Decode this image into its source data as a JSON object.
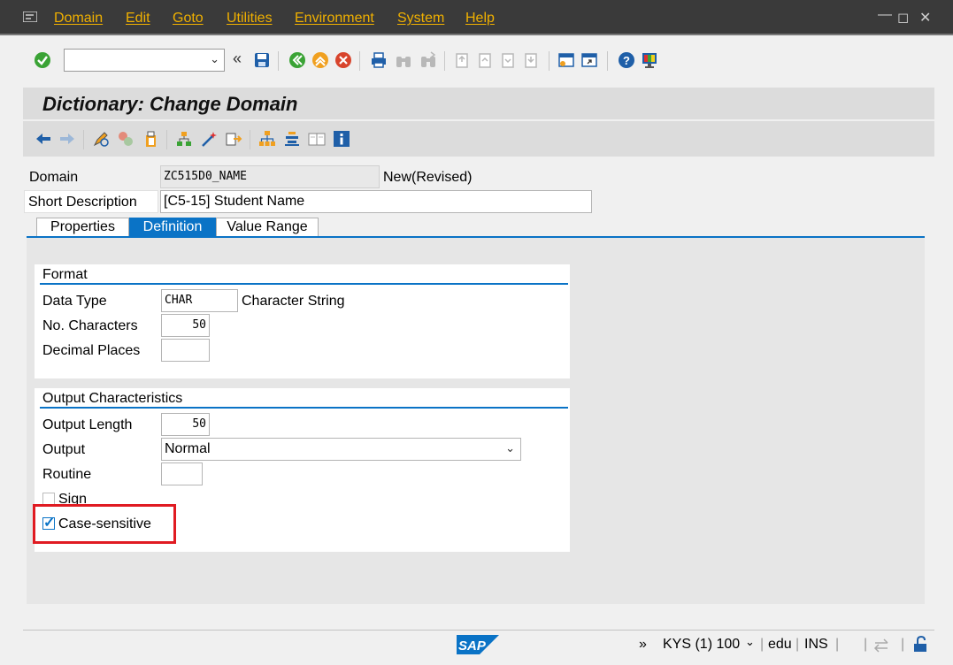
{
  "menubar": {
    "items": [
      "Domain",
      "Edit",
      "Goto",
      "Utilities",
      "Environment",
      "System",
      "Help"
    ]
  },
  "toolbar": {
    "command_value": "",
    "icons": [
      "enter-icon",
      "back-arrows-icon",
      "save-icon",
      "back-icon",
      "exit-icon",
      "cancel-icon",
      "print-icon",
      "find-icon",
      "find-next-icon",
      "first-page-icon",
      "previous-page-icon",
      "next-page-icon",
      "last-page-icon",
      "create-session-icon",
      "shortcut-icon",
      "help-icon",
      "customize-layout-icon"
    ]
  },
  "title": "Dictionary: Change Domain",
  "header": {
    "domain_label": "Domain",
    "domain_value": "ZC515D0_NAME",
    "status": "New(Revised)",
    "short_desc_label": "Short Description",
    "short_desc_value": "[C5-15] Student Name"
  },
  "tabs": [
    {
      "label": "Properties",
      "active": false
    },
    {
      "label": "Definition",
      "active": true
    },
    {
      "label": "Value Range",
      "active": false
    }
  ],
  "format": {
    "title": "Format",
    "data_type_label": "Data Type",
    "data_type_value": "CHAR",
    "data_type_desc": "Character String",
    "no_chars_label": "No. Characters",
    "no_chars_value": "50",
    "decimal_label": "Decimal Places",
    "decimal_value": ""
  },
  "output": {
    "title": "Output Characteristics",
    "length_label": "Output Length",
    "length_value": "50",
    "output_label": "Output",
    "output_value": "Normal",
    "routine_label": "Routine",
    "routine_value": "",
    "sign_label": "Sign",
    "sign_checked": false,
    "case_label": "Case-sensitive",
    "case_checked": true
  },
  "statusbar": {
    "expand": "»",
    "system": "KYS (1) 100",
    "client": "edu",
    "mode": "INS"
  },
  "colors": {
    "menu_bg": "#3a3a3a",
    "menu_text": "#f0b000",
    "accent": "#0a73c6",
    "highlight": "#e01b22"
  }
}
